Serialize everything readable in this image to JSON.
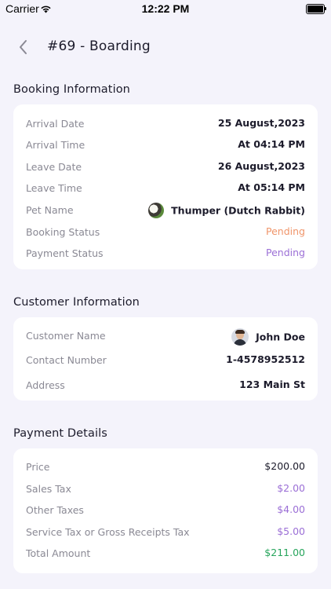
{
  "status_bar": {
    "carrier": "Carrier",
    "time": "12:22 PM"
  },
  "header": {
    "title": "#69 - Boarding"
  },
  "booking": {
    "title": "Booking Information",
    "rows": [
      {
        "label": "Arrival Date",
        "value": "25 August,2023"
      },
      {
        "label": "Arrival Time",
        "value": "At 04:14 PM"
      },
      {
        "label": "Leave Date",
        "value": "26 August,2023"
      },
      {
        "label": "Leave Time",
        "value": "At 05:14 PM"
      },
      {
        "label": "Pet Name",
        "value": "Thumper (Dutch Rabbit)"
      },
      {
        "label": "Booking Status",
        "value": "Pending"
      },
      {
        "label": "Payment Status",
        "value": "Pending"
      }
    ]
  },
  "customer": {
    "title": "Customer Information",
    "rows": [
      {
        "label": "Customer Name",
        "value": "John Doe"
      },
      {
        "label": "Contact Number",
        "value": "1-4578952512"
      },
      {
        "label": "Address",
        "value": "123 Main St"
      }
    ]
  },
  "payment": {
    "title": "Payment Details",
    "rows": [
      {
        "label": "Price",
        "value": "$200.00"
      },
      {
        "label": "Sales Tax",
        "value": "$2.00"
      },
      {
        "label": "Other Taxes",
        "value": "$4.00"
      },
      {
        "label": "Service Tax or Gross Receipts Tax",
        "value": "$5.00"
      },
      {
        "label": "Total Amount",
        "value": "$211.00"
      }
    ]
  },
  "colors": {
    "background": "#f4f3fb",
    "pending_booking": "#f0956a",
    "pending_payment": "#9b6fd6",
    "tax_purple": "#9b6fd6",
    "total_green": "#27a55c"
  }
}
